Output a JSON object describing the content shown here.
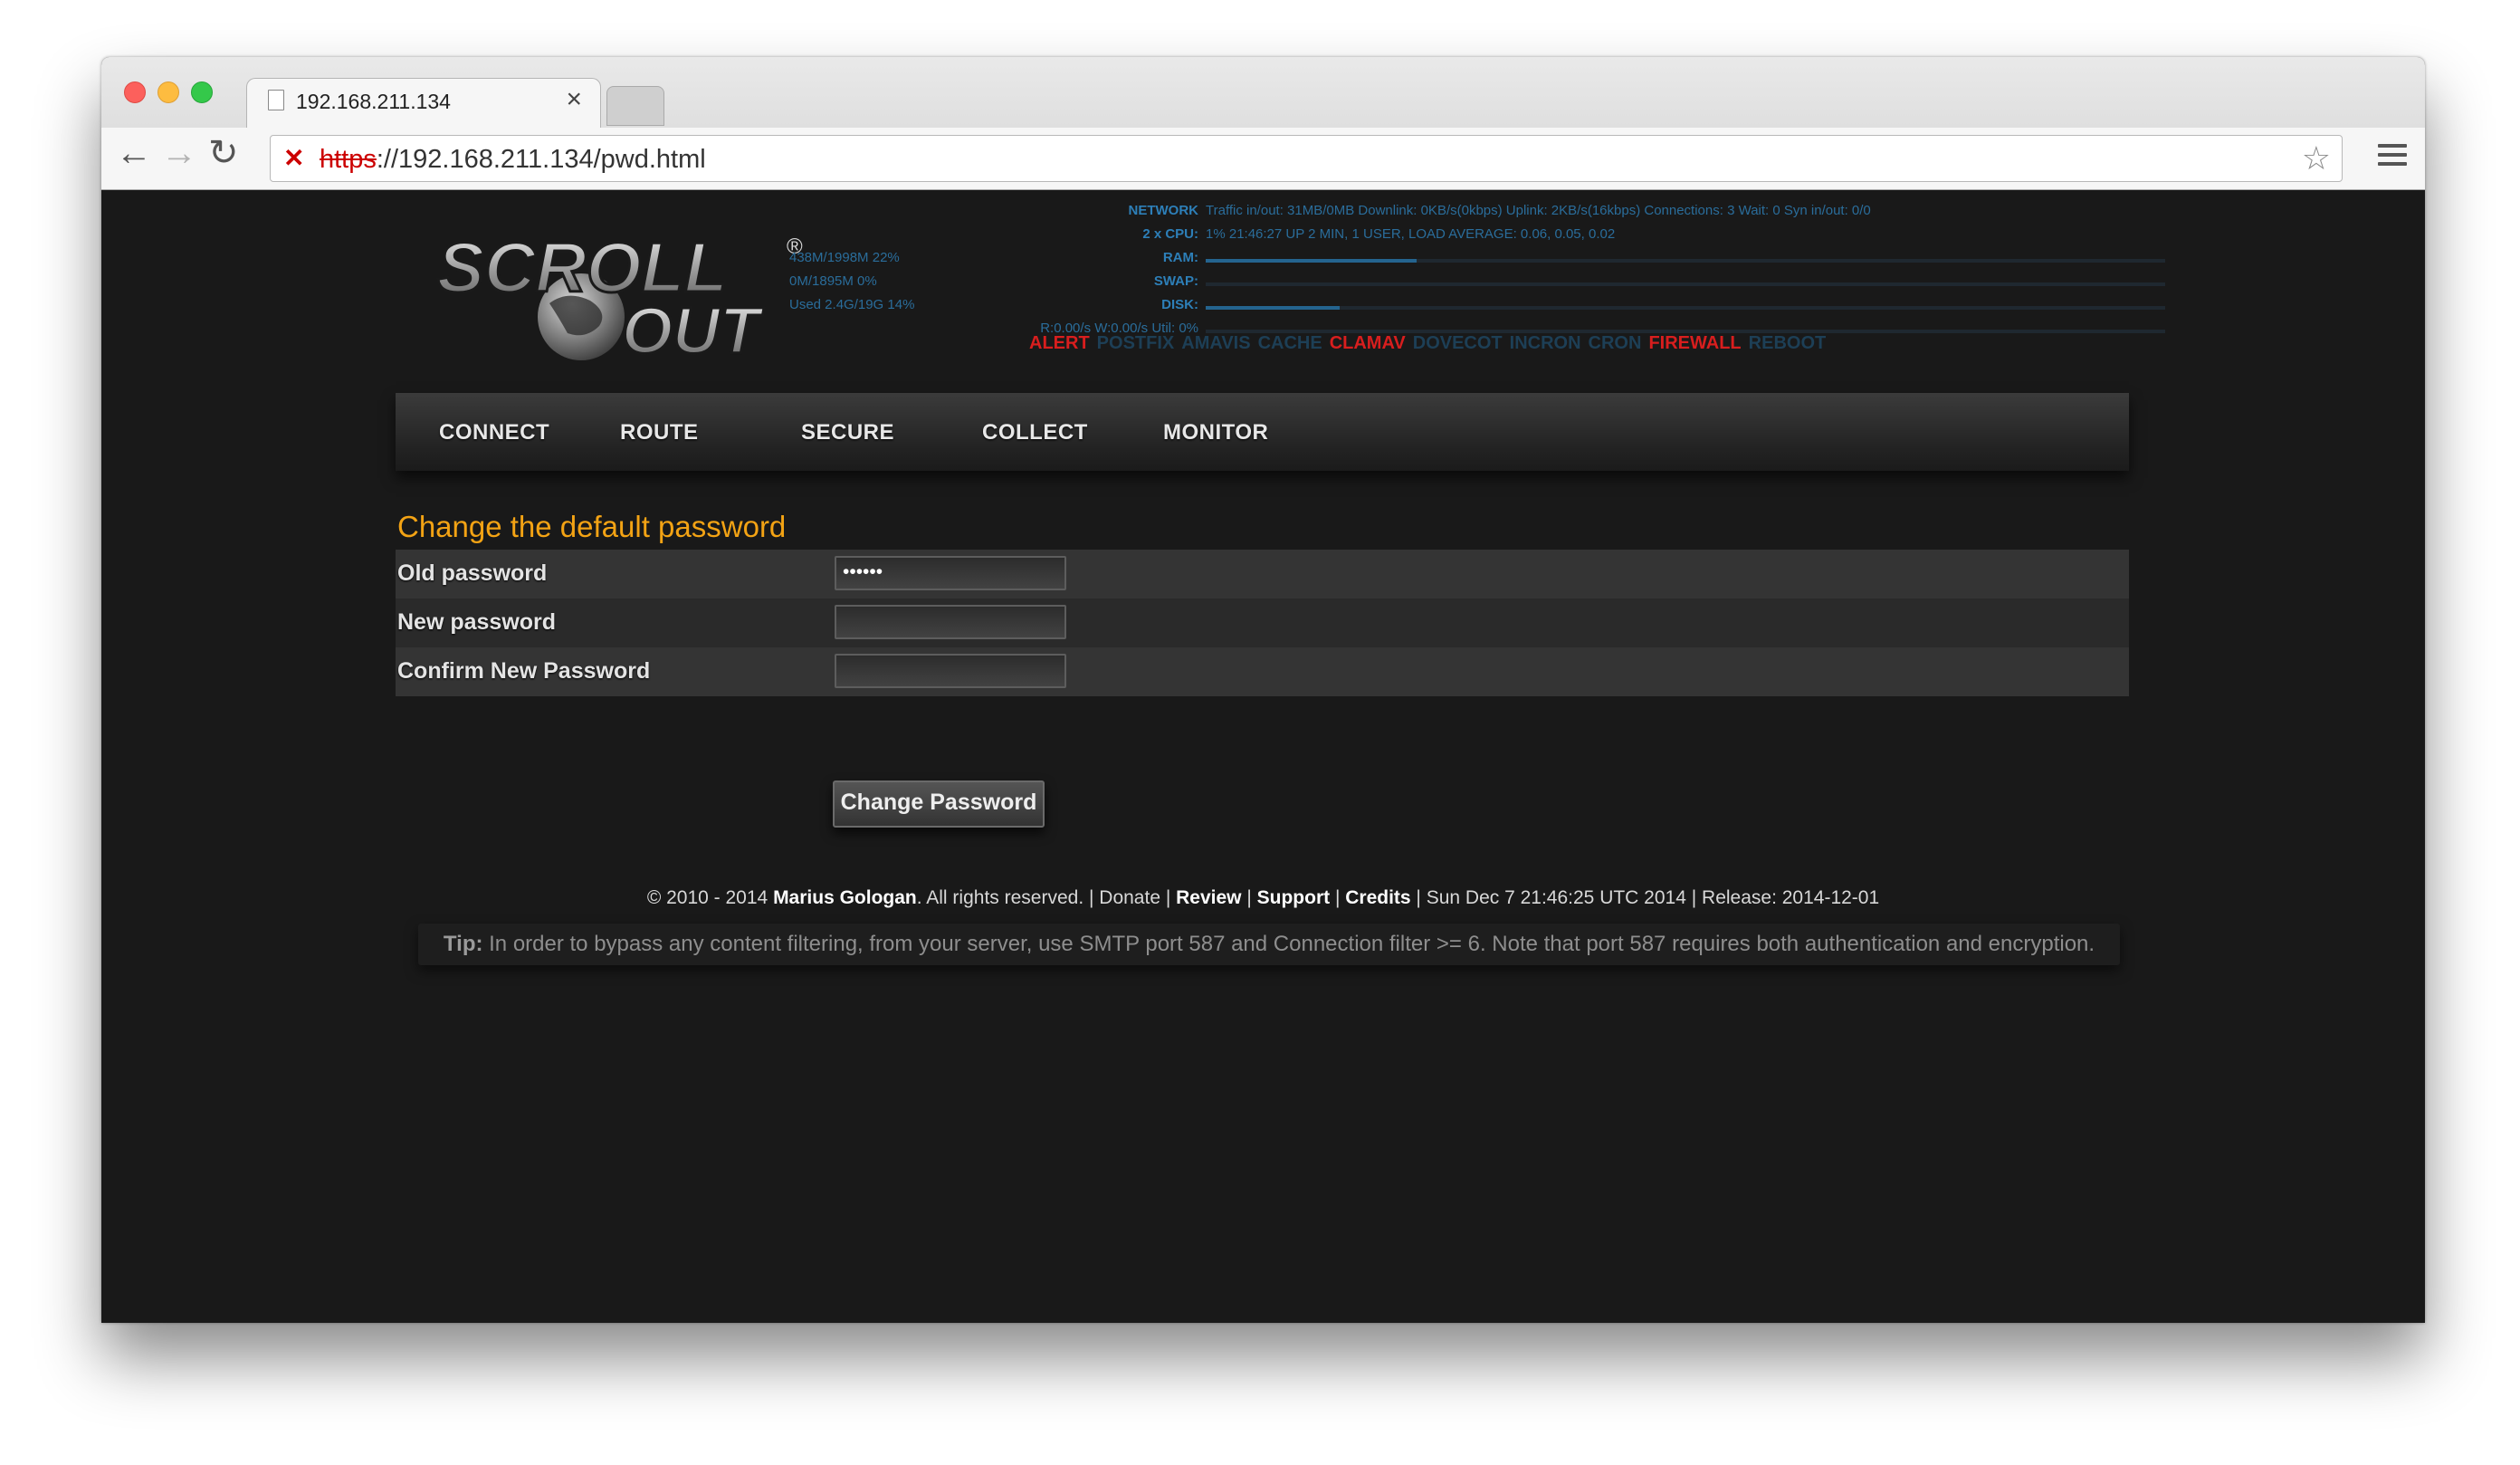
{
  "browser": {
    "tab_title": "192.168.211.134",
    "tab_close": "×",
    "url_scheme": "https",
    "url_rest": "://192.168.211.134/pwd.html",
    "back_icon": "←",
    "forward_icon": "→",
    "reload_icon": "↻",
    "star_icon": "☆",
    "lock_icon": "✕",
    "traffic_lights": {
      "close": "#fc605c",
      "minimize": "#fdbc40",
      "maximize": "#34c84a"
    }
  },
  "logo": {
    "line1": "SCROLL",
    "line2": "OUT",
    "reg": "®"
  },
  "stats": {
    "network_label": "NETWORK",
    "network_value": "Traffic in/out: 31MB/0MB  Downlink: 0KB/s(0kbps)  Uplink: 2KB/s(16kbps)  Connections: 3  Wait: 0  Syn in/out: 0/0",
    "cpu_label": "2 x CPU:",
    "cpu_value": "1%  21:46:27 UP 2 MIN, 1 USER, LOAD AVERAGE: 0.06, 0.05, 0.02",
    "cpu_fraction": 0.01,
    "ram_label": "RAM:",
    "ram_value": "438M/1998M 22%",
    "ram_fraction": 0.22,
    "swap_label": "SWAP:",
    "swap_value": "0M/1895M 0%",
    "swap_fraction": 0.0,
    "disk_label": "DISK:",
    "disk_value": "Used 2.4G/19G 14%",
    "disk_fraction": 0.14,
    "io_label": "R:0.00/s W:0.00/s Util: 0%",
    "io_fraction": 0.0
  },
  "services": [
    {
      "name": "ALERT",
      "color": "#d81e1e"
    },
    {
      "name": "POSTFIX",
      "color": "#1d3f56"
    },
    {
      "name": "AMAVIS",
      "color": "#1d3f56"
    },
    {
      "name": "CACHE",
      "color": "#1d3f56"
    },
    {
      "name": "CLAMAV",
      "color": "#d81e1e"
    },
    {
      "name": "DOVECOT",
      "color": "#1d3f56"
    },
    {
      "name": "INCRON",
      "color": "#1d3f56"
    },
    {
      "name": "CRON",
      "color": "#1d3f56"
    },
    {
      "name": "FIREWALL",
      "color": "#d81e1e"
    },
    {
      "name": "REBOOT",
      "color": "#1d3f56"
    }
  ],
  "nav": [
    "CONNECT",
    "ROUTE",
    "SECURE",
    "COLLECT",
    "MONITOR"
  ],
  "form": {
    "heading": "Change the default password",
    "old_label": "Old password",
    "old_value": "••••••",
    "new_label": "New password",
    "new_value": "",
    "confirm_label": "Confirm New Password",
    "confirm_value": "",
    "submit": "Change Password"
  },
  "footer": {
    "copyright": "© 2010 - 2014 ",
    "author": "Marius Gologan",
    "rights": ". All rights reserved. | ",
    "donate": "Donate",
    "sep1": " | ",
    "review": "Review",
    "sep2": " | ",
    "support": "Support",
    "sep3": " | ",
    "credits": "Credits",
    "tail": " | Sun Dec 7 21:46:25 UTC 2014 | Release: 2014-12-01"
  },
  "tip": {
    "label": "Tip:",
    "text": " In order to bypass any content filtering, from your server, use SMTP port 587 and Connection filter >= 6. Note that port 587 requires both authentication and encryption."
  }
}
